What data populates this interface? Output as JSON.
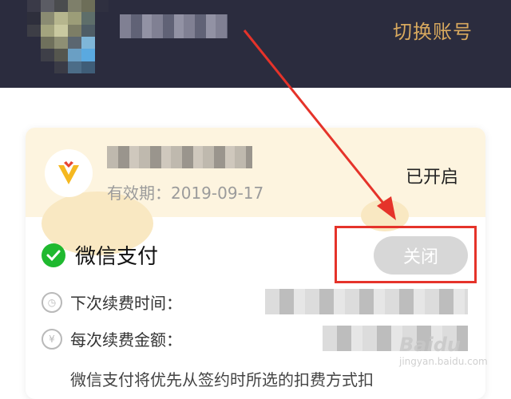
{
  "header": {
    "switch_account": "切换账号"
  },
  "card": {
    "validity": "有效期：2019-09-17",
    "status": "已开启"
  },
  "payment": {
    "title": "微信支付",
    "close_button": "关闭",
    "next_renewal_label": "下次续费时间：",
    "renewal_amount_label": "每次续费金额：",
    "description": "微信支付将优先从签约时所选的扣费方式扣"
  },
  "watermark": {
    "brand": "Baidu",
    "sub": "jingyan.baidu.com"
  },
  "colors": {
    "header_bg": "#2b2c3e",
    "accent_gold": "#d8a95e",
    "wechat_green": "#1fb92f",
    "highlight_red": "#e5332a"
  }
}
